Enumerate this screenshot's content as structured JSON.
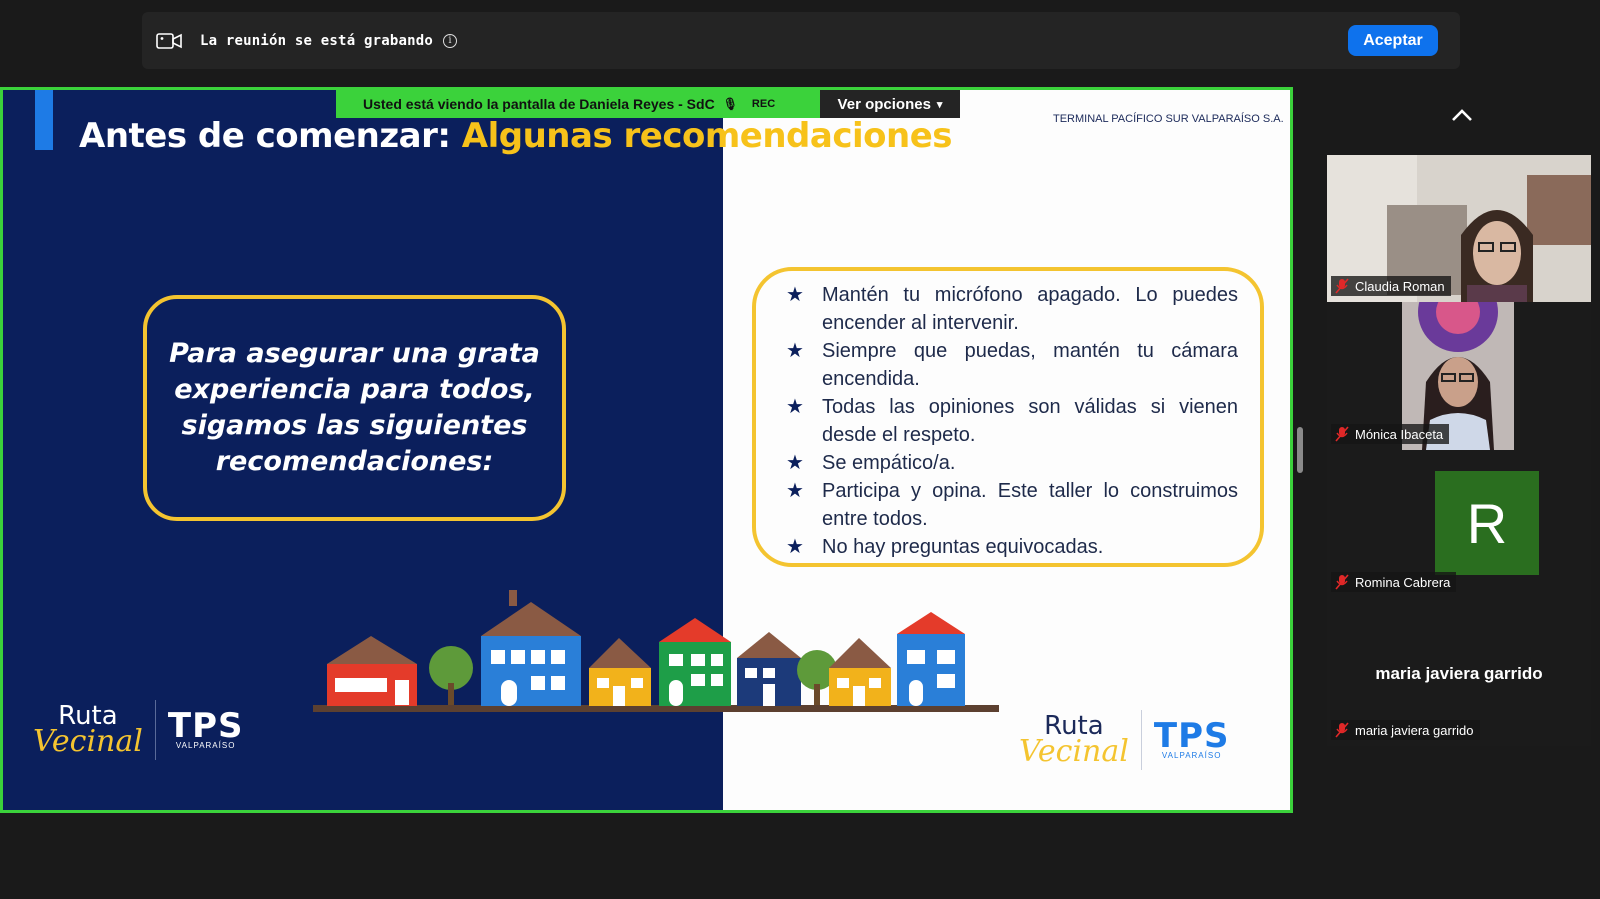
{
  "recording_banner": {
    "text": "La reunión se está grabando",
    "accept_label": "Aceptar"
  },
  "share_bar": {
    "viewing_text": "Usted está viendo la pantalla de  Daniela Reyes - SdC",
    "rec_label": "REC",
    "view_options_label": "Ver opciones"
  },
  "slide": {
    "title_white": "Antes de comenzar: ",
    "title_yellow": "Algunas recomendaciones",
    "company": "TERMINAL PACÍFICO SUR VALPARAÍSO S.A.",
    "intro": "Para asegurar una grata experiencia para todos, sigamos las siguientes recomendaciones:",
    "recommendations": [
      "Mantén tu micrófono apagado. Lo puedes encender al intervenir.",
      "Siempre que puedas, mantén tu cámara encendida.",
      "Todas las opiniones son válidas si vienen desde el respeto.",
      "Se empático/a.",
      "Participa y opina. Este taller lo construimos entre todos.",
      "No hay preguntas equivocadas."
    ],
    "logo_ruta": "Ruta",
    "logo_vecinal": "Vecinal",
    "logo_tps": "TPS",
    "logo_valparaiso": "VALPARAÍSO"
  },
  "participants": [
    {
      "name": "Claudia Roman",
      "muted": true
    },
    {
      "name": "Mónica Ibaceta",
      "muted": true
    },
    {
      "name": "Romina Cabrera",
      "muted": true,
      "avatar_letter": "R"
    },
    {
      "name": "maria javiera garrido",
      "muted": true,
      "display_name": "maria javiera garrido"
    }
  ],
  "colors": {
    "share_border": "#3bd23b",
    "slide_navy": "#0b1f5c",
    "slide_yellow": "#f7c21a",
    "accept_blue": "#0e72ed",
    "avatar_green": "#2a6e1f"
  }
}
